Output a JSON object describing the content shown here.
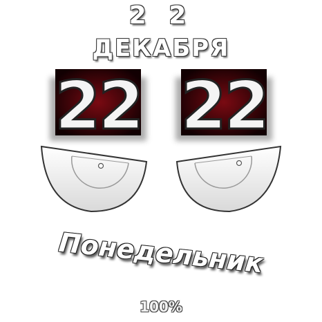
{
  "date": {
    "day": "2 2",
    "month": "ДЕКАБРЯ"
  },
  "time": {
    "hours": "22",
    "minutes": "22"
  },
  "weekday": "Понедельник",
  "battery": "100%",
  "colors": {
    "digit_tile_dark": "#140003",
    "digit_tile_red": "#7a0a12",
    "digit_fill": "#f4f4f4",
    "outline": "#333333"
  }
}
